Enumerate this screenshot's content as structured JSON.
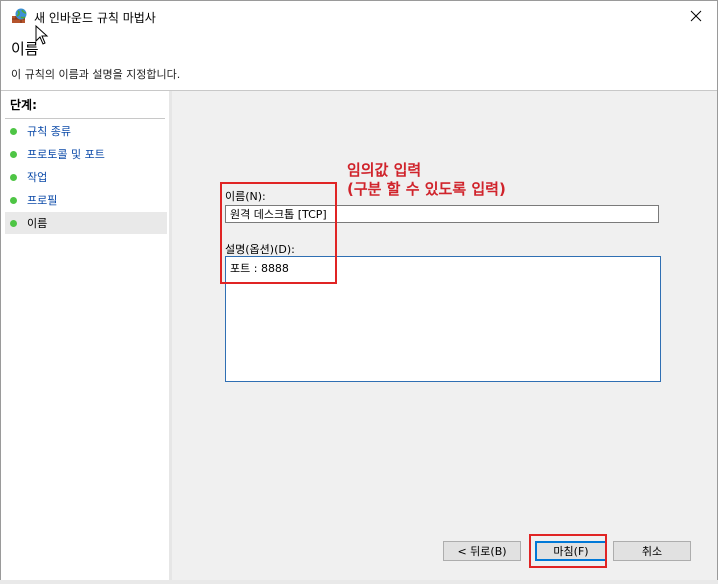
{
  "window": {
    "title": "새 인바운드 규칙 마법사",
    "icon": "firewall-globe-icon"
  },
  "header": {
    "title": "이름",
    "subtitle": "이 규칙의 이름과 설명을 지정합니다."
  },
  "sidebar": {
    "heading": "단계:",
    "steps": [
      {
        "label": "규칙 종류",
        "active": false
      },
      {
        "label": "프로토콜 및 포트",
        "active": false
      },
      {
        "label": "작업",
        "active": false
      },
      {
        "label": "프로필",
        "active": false
      },
      {
        "label": "이름",
        "active": true
      }
    ]
  },
  "form": {
    "name_label": "이름(N):",
    "name_value": "원격 데스크톱 [TCP]",
    "desc_label": "설명(옵션)(D):",
    "desc_value": "포트 : 8888"
  },
  "annotation": {
    "line1": "임의값 입력",
    "line2": "(구분 할 수 있도록 입력)",
    "color": "#d0232b"
  },
  "buttons": {
    "back": "< 뒤로(B)",
    "finish": "마침(F)",
    "cancel": "취소"
  },
  "colors": {
    "accent": "#0078d7",
    "highlight_box": "#e02424",
    "step_bullet": "#4ec545",
    "step_link": "#0a49a8"
  }
}
